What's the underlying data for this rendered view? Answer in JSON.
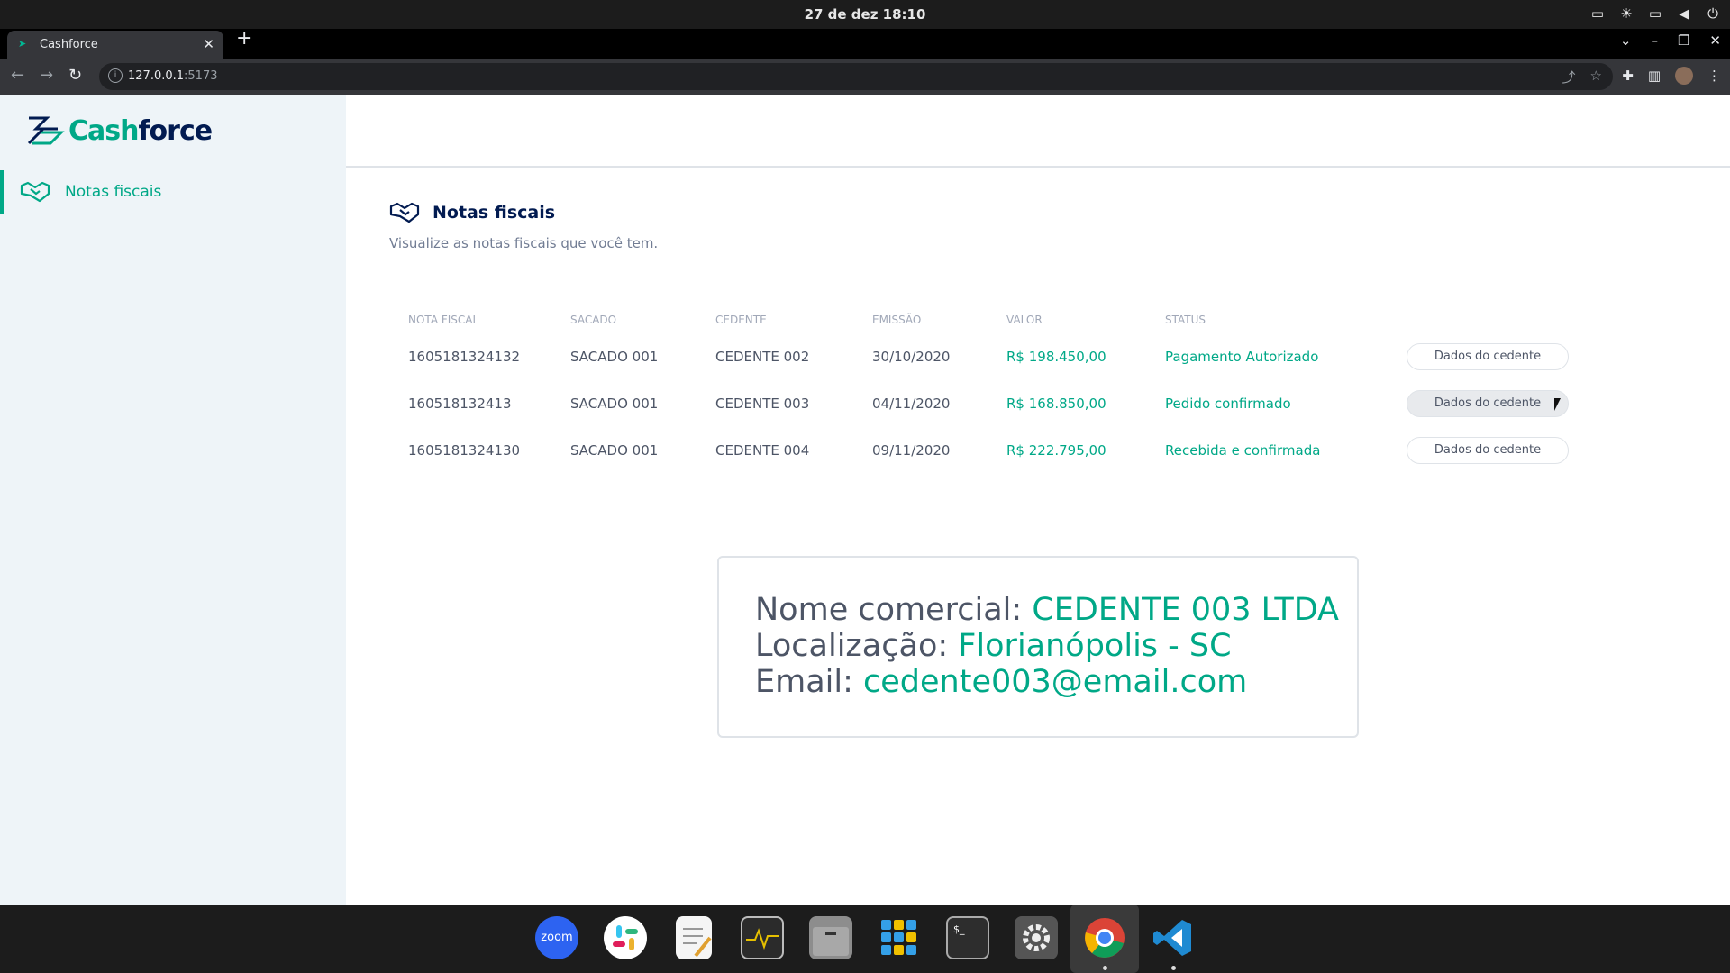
{
  "system": {
    "clock": "27 de dez  18:10"
  },
  "browser": {
    "tab_title": "Cashforce",
    "url_host": "127.0.0.1",
    "url_port": ":5173"
  },
  "app": {
    "logo_part1": "Cash",
    "logo_part2": "force",
    "sidebar": {
      "items": [
        {
          "label": "Notas fiscais",
          "icon": "handshake-icon",
          "active": true
        }
      ]
    },
    "page": {
      "title": "Notas fiscais",
      "subtitle": "Visualize as notas fiscais que você tem."
    },
    "table": {
      "headers": [
        "NOTA FISCAL",
        "SACADO",
        "CEDENTE",
        "EMISSÃO",
        "VALOR",
        "STATUS"
      ],
      "rows": [
        {
          "nota": "1605181324132",
          "sacado": "SACADO 001",
          "cedente": "CEDENTE 002",
          "emissao": "30/10/2020",
          "valor": "R$ 198.450,00",
          "status": "Pagamento Autorizado",
          "action": "Dados do cedente"
        },
        {
          "nota": "160518132413",
          "sacado": "SACADO 001",
          "cedente": "CEDENTE 003",
          "emissao": "04/11/2020",
          "valor": "R$ 168.850,00",
          "status": "Pedido confirmado",
          "action": "Dados do cedente"
        },
        {
          "nota": "1605181324130",
          "sacado": "SACADO 001",
          "cedente": "CEDENTE 004",
          "emissao": "09/11/2020",
          "valor": "R$ 222.795,00",
          "status": "Recebida e confirmada",
          "action": "Dados do cedente"
        }
      ]
    },
    "detail": {
      "nome_label": "Nome comercial: ",
      "nome_value": "CEDENTE 003 LTDA",
      "local_label": "Localização: ",
      "local_value": "Florianópolis - SC",
      "email_label": "Email: ",
      "email_value": "cedente003@email.com"
    },
    "colors": {
      "accent": "#00a887",
      "brand_dark": "#021b51",
      "text": "#4d5566",
      "sidebar_bg": "#eef4f8"
    }
  },
  "dock": {
    "apps": [
      "zoom-icon",
      "slack-icon",
      "text-editor-icon",
      "system-monitor-icon",
      "files-icon",
      "app-grid-icon",
      "terminal-icon",
      "settings-icon",
      "chrome-icon",
      "vscode-icon"
    ],
    "zoom_label": "zoom"
  }
}
